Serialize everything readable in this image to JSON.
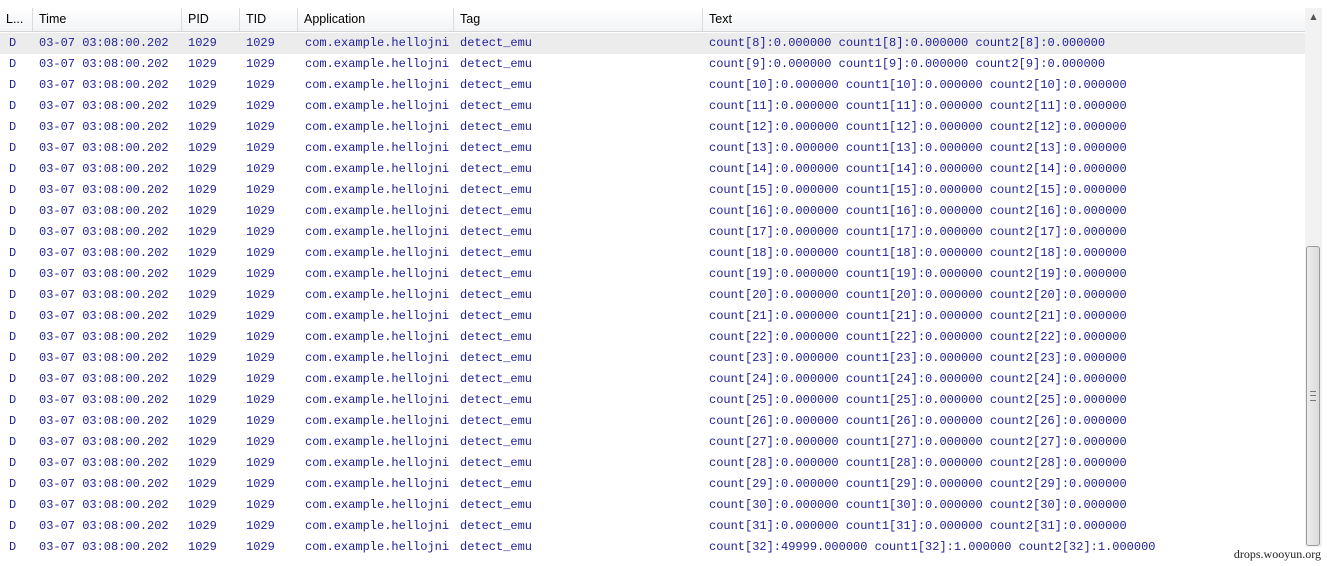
{
  "columns": [
    "L...",
    "Time",
    "PID",
    "TID",
    "Application",
    "Tag",
    "Text"
  ],
  "rows": [
    {
      "level": "D",
      "time": "03-07 03:08:00.202",
      "pid": "1029",
      "tid": "1029",
      "app": "com.example.hellojni",
      "tag": "detect_emu",
      "text": "count[8]:0.000000 count1[8]:0.000000 count2[8]:0.000000",
      "selected": true
    },
    {
      "level": "D",
      "time": "03-07 03:08:00.202",
      "pid": "1029",
      "tid": "1029",
      "app": "com.example.hellojni",
      "tag": "detect_emu",
      "text": "count[9]:0.000000 count1[9]:0.000000 count2[9]:0.000000"
    },
    {
      "level": "D",
      "time": "03-07 03:08:00.202",
      "pid": "1029",
      "tid": "1029",
      "app": "com.example.hellojni",
      "tag": "detect_emu",
      "text": "count[10]:0.000000 count1[10]:0.000000 count2[10]:0.000000"
    },
    {
      "level": "D",
      "time": "03-07 03:08:00.202",
      "pid": "1029",
      "tid": "1029",
      "app": "com.example.hellojni",
      "tag": "detect_emu",
      "text": "count[11]:0.000000 count1[11]:0.000000 count2[11]:0.000000"
    },
    {
      "level": "D",
      "time": "03-07 03:08:00.202",
      "pid": "1029",
      "tid": "1029",
      "app": "com.example.hellojni",
      "tag": "detect_emu",
      "text": "count[12]:0.000000 count1[12]:0.000000 count2[12]:0.000000"
    },
    {
      "level": "D",
      "time": "03-07 03:08:00.202",
      "pid": "1029",
      "tid": "1029",
      "app": "com.example.hellojni",
      "tag": "detect_emu",
      "text": "count[13]:0.000000 count1[13]:0.000000 count2[13]:0.000000"
    },
    {
      "level": "D",
      "time": "03-07 03:08:00.202",
      "pid": "1029",
      "tid": "1029",
      "app": "com.example.hellojni",
      "tag": "detect_emu",
      "text": "count[14]:0.000000 count1[14]:0.000000 count2[14]:0.000000"
    },
    {
      "level": "D",
      "time": "03-07 03:08:00.202",
      "pid": "1029",
      "tid": "1029",
      "app": "com.example.hellojni",
      "tag": "detect_emu",
      "text": "count[15]:0.000000 count1[15]:0.000000 count2[15]:0.000000"
    },
    {
      "level": "D",
      "time": "03-07 03:08:00.202",
      "pid": "1029",
      "tid": "1029",
      "app": "com.example.hellojni",
      "tag": "detect_emu",
      "text": "count[16]:0.000000 count1[16]:0.000000 count2[16]:0.000000"
    },
    {
      "level": "D",
      "time": "03-07 03:08:00.202",
      "pid": "1029",
      "tid": "1029",
      "app": "com.example.hellojni",
      "tag": "detect_emu",
      "text": "count[17]:0.000000 count1[17]:0.000000 count2[17]:0.000000"
    },
    {
      "level": "D",
      "time": "03-07 03:08:00.202",
      "pid": "1029",
      "tid": "1029",
      "app": "com.example.hellojni",
      "tag": "detect_emu",
      "text": "count[18]:0.000000 count1[18]:0.000000 count2[18]:0.000000"
    },
    {
      "level": "D",
      "time": "03-07 03:08:00.202",
      "pid": "1029",
      "tid": "1029",
      "app": "com.example.hellojni",
      "tag": "detect_emu",
      "text": "count[19]:0.000000 count1[19]:0.000000 count2[19]:0.000000"
    },
    {
      "level": "D",
      "time": "03-07 03:08:00.202",
      "pid": "1029",
      "tid": "1029",
      "app": "com.example.hellojni",
      "tag": "detect_emu",
      "text": "count[20]:0.000000 count1[20]:0.000000 count2[20]:0.000000"
    },
    {
      "level": "D",
      "time": "03-07 03:08:00.202",
      "pid": "1029",
      "tid": "1029",
      "app": "com.example.hellojni",
      "tag": "detect_emu",
      "text": "count[21]:0.000000 count1[21]:0.000000 count2[21]:0.000000"
    },
    {
      "level": "D",
      "time": "03-07 03:08:00.202",
      "pid": "1029",
      "tid": "1029",
      "app": "com.example.hellojni",
      "tag": "detect_emu",
      "text": "count[22]:0.000000 count1[22]:0.000000 count2[22]:0.000000"
    },
    {
      "level": "D",
      "time": "03-07 03:08:00.202",
      "pid": "1029",
      "tid": "1029",
      "app": "com.example.hellojni",
      "tag": "detect_emu",
      "text": "count[23]:0.000000 count1[23]:0.000000 count2[23]:0.000000"
    },
    {
      "level": "D",
      "time": "03-07 03:08:00.202",
      "pid": "1029",
      "tid": "1029",
      "app": "com.example.hellojni",
      "tag": "detect_emu",
      "text": "count[24]:0.000000 count1[24]:0.000000 count2[24]:0.000000"
    },
    {
      "level": "D",
      "time": "03-07 03:08:00.202",
      "pid": "1029",
      "tid": "1029",
      "app": "com.example.hellojni",
      "tag": "detect_emu",
      "text": "count[25]:0.000000 count1[25]:0.000000 count2[25]:0.000000"
    },
    {
      "level": "D",
      "time": "03-07 03:08:00.202",
      "pid": "1029",
      "tid": "1029",
      "app": "com.example.hellojni",
      "tag": "detect_emu",
      "text": "count[26]:0.000000 count1[26]:0.000000 count2[26]:0.000000"
    },
    {
      "level": "D",
      "time": "03-07 03:08:00.202",
      "pid": "1029",
      "tid": "1029",
      "app": "com.example.hellojni",
      "tag": "detect_emu",
      "text": "count[27]:0.000000 count1[27]:0.000000 count2[27]:0.000000"
    },
    {
      "level": "D",
      "time": "03-07 03:08:00.202",
      "pid": "1029",
      "tid": "1029",
      "app": "com.example.hellojni",
      "tag": "detect_emu",
      "text": "count[28]:0.000000 count1[28]:0.000000 count2[28]:0.000000"
    },
    {
      "level": "D",
      "time": "03-07 03:08:00.202",
      "pid": "1029",
      "tid": "1029",
      "app": "com.example.hellojni",
      "tag": "detect_emu",
      "text": "count[29]:0.000000 count1[29]:0.000000 count2[29]:0.000000"
    },
    {
      "level": "D",
      "time": "03-07 03:08:00.202",
      "pid": "1029",
      "tid": "1029",
      "app": "com.example.hellojni",
      "tag": "detect_emu",
      "text": "count[30]:0.000000 count1[30]:0.000000 count2[30]:0.000000"
    },
    {
      "level": "D",
      "time": "03-07 03:08:00.202",
      "pid": "1029",
      "tid": "1029",
      "app": "com.example.hellojni",
      "tag": "detect_emu",
      "text": "count[31]:0.000000 count1[31]:0.000000 count2[31]:0.000000"
    },
    {
      "level": "D",
      "time": "03-07 03:08:00.202",
      "pid": "1029",
      "tid": "1029",
      "app": "com.example.hellojni",
      "tag": "detect_emu",
      "text": "count[32]:49999.000000 count1[32]:1.000000 count2[32]:1.000000"
    }
  ],
  "scrollbar": {
    "up_icon": "scroll-up-arrow-icon",
    "up_glyph": "▲",
    "position_fraction": 0.44
  },
  "watermark": "drops.wooyun.org",
  "colors": {
    "text": "#1f1f96",
    "selected_row": "#ececec"
  }
}
